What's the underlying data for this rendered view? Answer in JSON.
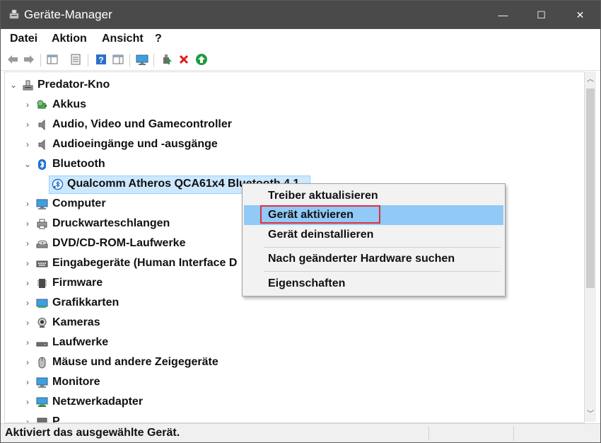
{
  "window": {
    "title": "Geräte-Manager",
    "controls": {
      "minimize": "—",
      "maximize": "☐",
      "close": "✕"
    }
  },
  "menu": {
    "items": [
      "Datei",
      "Aktion",
      "Ansicht",
      "?"
    ]
  },
  "toolbar": {
    "icons": [
      "back-arrow-icon",
      "forward-arrow-icon",
      "console-tree-icon",
      "properties-icon",
      "help-icon",
      "action-pane-icon",
      "monitor-icon",
      "update-driver-icon",
      "uninstall-icon",
      "enable-device-icon"
    ]
  },
  "tree": {
    "root": "Predator-Kno",
    "categories": [
      {
        "label": "Akkus",
        "icon": "battery-icon",
        "expanded": false
      },
      {
        "label": "Audio, Video und Gamecontroller",
        "icon": "speaker-icon",
        "expanded": false
      },
      {
        "label": "Audioeingänge und -ausgänge",
        "icon": "speaker-icon",
        "expanded": false
      },
      {
        "label": "Bluetooth",
        "icon": "bluetooth-icon",
        "expanded": true
      },
      {
        "label": "Computer",
        "icon": "computer-icon",
        "expanded": false
      },
      {
        "label": "Druckwarteschlangen",
        "icon": "printer-icon",
        "expanded": false
      },
      {
        "label": "DVD/CD-ROM-Laufwerke",
        "icon": "disc-drive-icon",
        "expanded": false
      },
      {
        "label": "Eingabegeräte (Human Interface D",
        "icon": "keyboard-icon",
        "expanded": false
      },
      {
        "label": "Firmware",
        "icon": "firmware-icon",
        "expanded": false
      },
      {
        "label": "Grafikkarten",
        "icon": "display-adapter-icon",
        "expanded": false
      },
      {
        "label": "Kameras",
        "icon": "camera-icon",
        "expanded": false
      },
      {
        "label": "Laufwerke",
        "icon": "disk-drive-icon",
        "expanded": false
      },
      {
        "label": "Mäuse und andere Zeigegeräte",
        "icon": "mouse-icon",
        "expanded": false
      },
      {
        "label": "Monitore",
        "icon": "monitor-icon",
        "expanded": false
      },
      {
        "label": "Netzwerkadapter",
        "icon": "network-adapter-icon",
        "expanded": false
      }
    ],
    "bluetooth_child": "Qualcomm Atheros QCA61x4 Bluetooth 4.1",
    "partial_last_row": "P"
  },
  "context_menu": {
    "items": [
      {
        "label": "Treiber aktualisieren"
      },
      {
        "label": "Gerät aktivieren",
        "highlighted": true
      },
      {
        "label": "Gerät deinstallieren"
      },
      {
        "label": "Nach geänderter Hardware suchen"
      },
      {
        "label": "Eigenschaften"
      }
    ]
  },
  "status": {
    "text": "Aktiviert das ausgewählte Gerät."
  },
  "colors": {
    "titlebar": "#4a4a4a",
    "selection": "#cce8ff",
    "menu_highlight": "#91c9f7",
    "highlight_box": "#e0303a"
  }
}
